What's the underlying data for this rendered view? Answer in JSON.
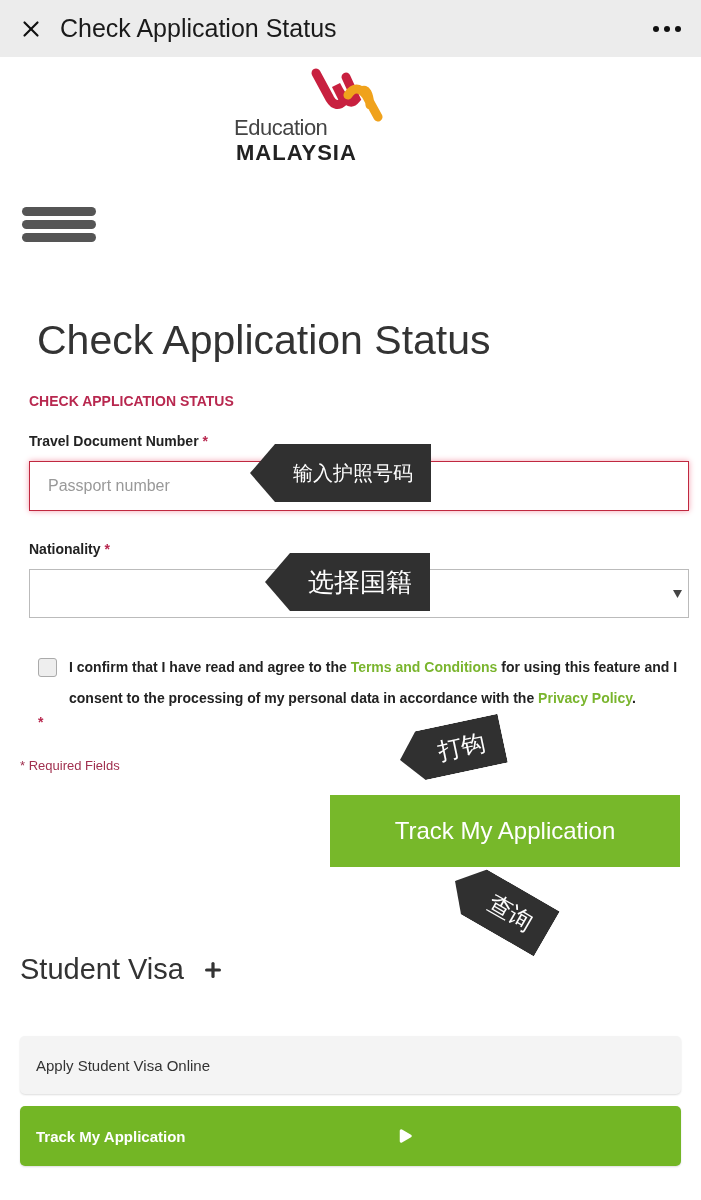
{
  "top_bar": {
    "title": "Check Application Status"
  },
  "logo": {
    "line1": "Education",
    "line2": "MALAYSIA"
  },
  "page_heading": "Check Application Status",
  "form": {
    "section_label": "CHECK APPLICATION STATUS",
    "travel_document": {
      "label": "Travel Document Number",
      "required_mark": "*",
      "placeholder": "Passport number",
      "focused": true
    },
    "nationality": {
      "label": "Nationality",
      "required_mark": "*"
    },
    "consent": {
      "checked": false,
      "before": "I confirm that I have read and agree to the",
      "terms_link": "Terms and Conditions",
      "middle": "for using this feature and I consent to the processing of my personal data in accordance with the",
      "privacy_link": "Privacy Policy",
      "after": ".",
      "required_mark": "*"
    },
    "required_note": "* Required Fields",
    "submit_button": "Track My Application"
  },
  "callouts": [
    {
      "kind": "field",
      "text": "输入护照号码"
    },
    {
      "kind": "select",
      "text": "选择国籍"
    },
    {
      "kind": "checkbox",
      "text": "打钩"
    },
    {
      "kind": "button",
      "text": "查询"
    }
  ],
  "student_visa": {
    "heading": "Student Visa",
    "links": [
      {
        "label": "Apply Student Visa Online",
        "selected": false
      },
      {
        "label": "Track My Application",
        "selected": true
      }
    ]
  }
}
